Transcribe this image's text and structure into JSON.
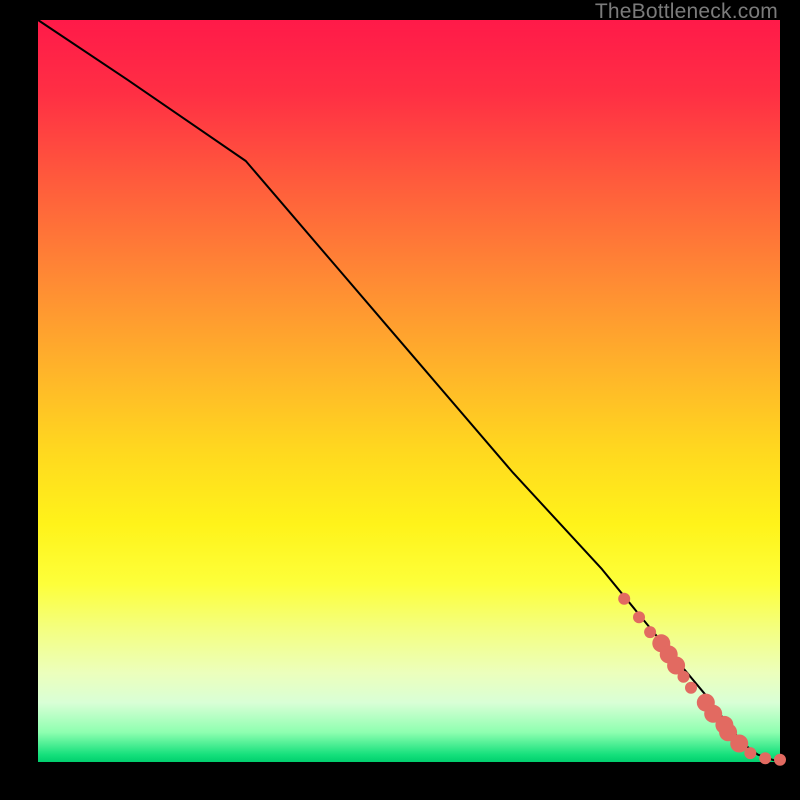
{
  "watermark": "TheBottleneck.com",
  "colors": {
    "marker": "#e26a61",
    "curve": "#000000"
  },
  "chart_data": {
    "type": "line",
    "title": "",
    "xlabel": "",
    "ylabel": "",
    "xlim": [
      0,
      100
    ],
    "ylim": [
      0,
      100
    ],
    "grid": false,
    "series": [
      {
        "name": "curve",
        "x": [
          0,
          12,
          28,
          40,
          52,
          64,
          76,
          85,
          90,
          93,
          95,
          97,
          99,
          100
        ],
        "y": [
          100,
          92,
          81,
          67,
          53,
          39,
          26,
          15,
          9,
          5,
          2.5,
          1,
          0.3,
          0
        ]
      }
    ],
    "markers": {
      "name": "highlighted-points",
      "x": [
        79,
        81,
        82.5,
        84,
        85,
        86,
        87,
        88,
        90,
        91,
        92.5,
        93,
        94.5,
        96,
        98,
        100
      ],
      "y": [
        22,
        19.5,
        17.5,
        16,
        14.5,
        13,
        11.5,
        10,
        8,
        6.5,
        5,
        4,
        2.5,
        1.2,
        0.5,
        0.3
      ],
      "size": [
        6,
        6,
        6,
        9,
        9,
        9,
        6,
        6,
        9,
        9,
        9,
        9,
        9,
        6,
        6,
        6
      ]
    }
  }
}
